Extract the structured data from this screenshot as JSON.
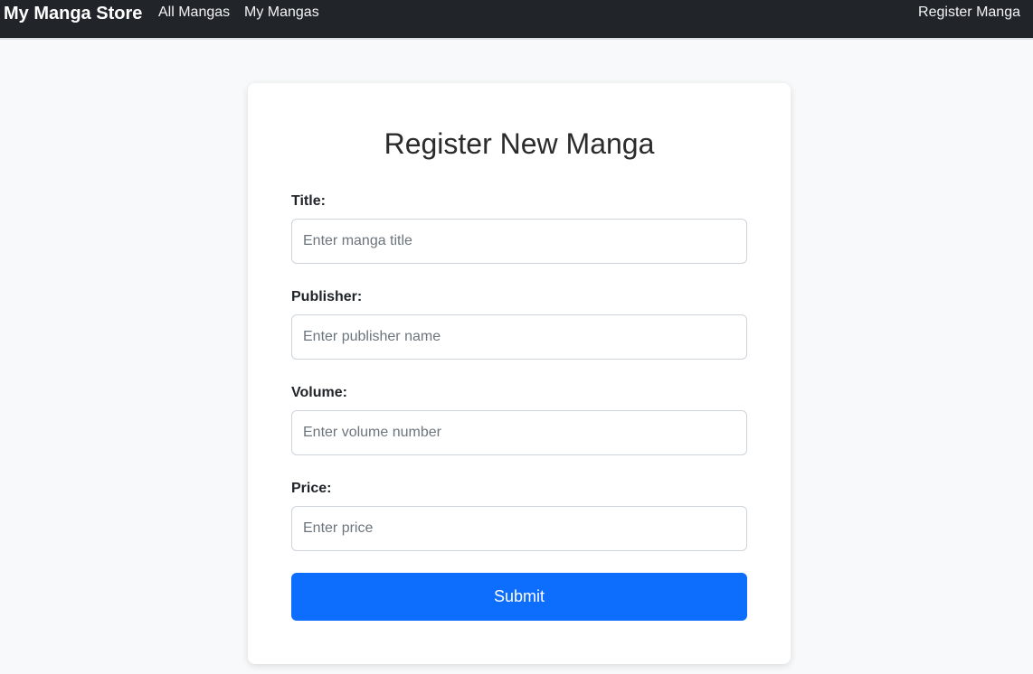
{
  "navbar": {
    "brand": "My Manga Store",
    "links": [
      {
        "label": "All Mangas"
      },
      {
        "label": "My Mangas"
      }
    ],
    "right_link": "Register Manga",
    "background": "#212529"
  },
  "form": {
    "title": "Register New Manga",
    "fields": [
      {
        "label": "Title:",
        "placeholder": "Enter manga title",
        "value": ""
      },
      {
        "label": "Publisher:",
        "placeholder": "Enter publisher name",
        "value": ""
      },
      {
        "label": "Volume:",
        "placeholder": "Enter volume number",
        "value": ""
      },
      {
        "label": "Price:",
        "placeholder": "Enter price",
        "value": ""
      }
    ],
    "submit_label": "Submit",
    "accent_color": "#0d6efd"
  }
}
